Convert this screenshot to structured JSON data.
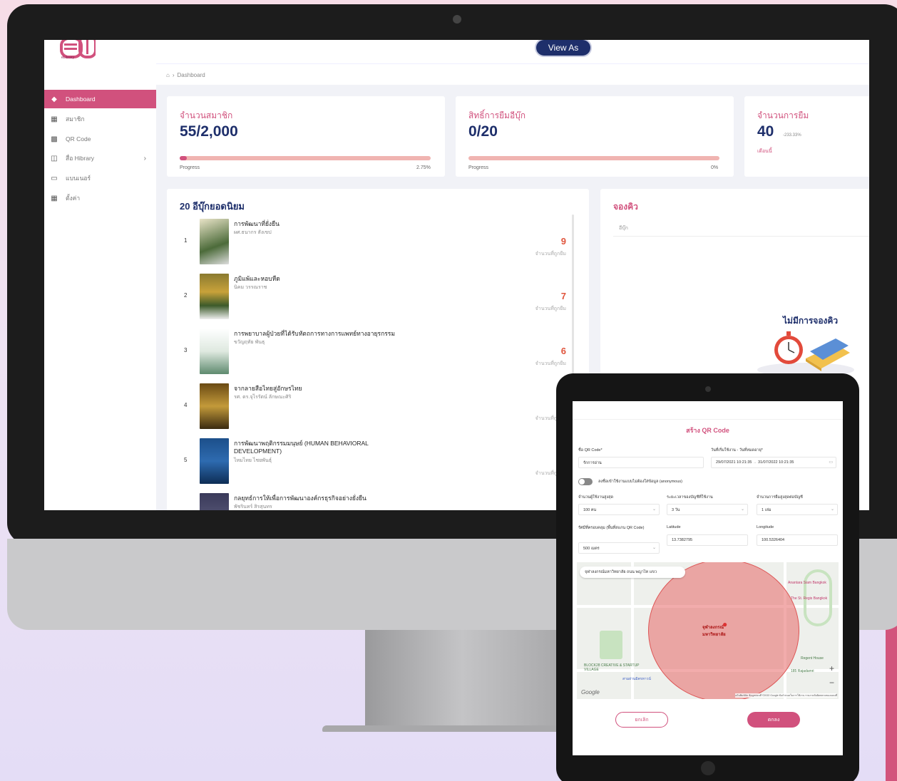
{
  "topbar": {
    "logo_text": "eLibrary",
    "view_as_label": "View As"
  },
  "breadcrumb": {
    "current": "Dashboard"
  },
  "sidebar": {
    "items": [
      {
        "label": "Dashboard",
        "icon": "home-icon"
      },
      {
        "label": "สมาชิก",
        "icon": "members-icon"
      },
      {
        "label": "QR Code",
        "icon": "qr-code-icon"
      },
      {
        "label": "สื่อ Hibrary",
        "icon": "book-icon"
      },
      {
        "label": "แบนเนอร์",
        "icon": "banner-icon"
      },
      {
        "label": "ตั้งค่า",
        "icon": "settings-icon"
      }
    ]
  },
  "stats": {
    "members": {
      "title": "จำนวนสมาชิก",
      "value": "55/2,000",
      "progress_label": "Progress",
      "progress_value": "2.75%",
      "progress": 0.0275
    },
    "rights": {
      "title": "สิทธิ์การยืมอีบุ๊ก",
      "value": "0/20",
      "progress_label": "Progress",
      "progress_value": "0%",
      "progress": 0
    },
    "borrows": {
      "title": "จำนวนการยืม",
      "value": "40",
      "change": "-233.33%",
      "period": "เดือนนี้"
    }
  },
  "popular": {
    "title": "20 อีบุ๊กยอดนิยม",
    "count_label": "จำนวนที่ถูกยืม",
    "books": [
      {
        "rank": "1",
        "title": "การพัฒนาที่ยั่งยืน",
        "author": "ผศ.ธนากร สังเขป",
        "count": "9",
        "cover": "#4c6b3a"
      },
      {
        "rank": "2",
        "title": "ภูมิแพ้และหอบหืด",
        "author": "นิคม วรรณราช",
        "count": "7",
        "cover": "#8a7a30"
      },
      {
        "rank": "3",
        "title": "การพยาบาลผู้ป่วยที่ได้รับหัตถการทางการแพทย์ทางอายุรกรรม",
        "author": "ขวัญฤทัย พันธุ",
        "count": "6",
        "cover": "#5e8a6e"
      },
      {
        "rank": "4",
        "title": "จากลายสือไทยสู่อักษรไทย",
        "author": "รศ. ดร.จุไรรัตน์ ลักษณะศิริ",
        "count": "",
        "cover": "#7a5a1e"
      },
      {
        "rank": "5",
        "title": "การพัฒนาพฤติกรรมมนุษย์ (HUMAN BEHAVIORAL DEVELOPMENT)",
        "author": "ไหมไทย ไชยพันธุ์",
        "count": "",
        "cover": "#1c4f8a"
      },
      {
        "rank": "",
        "title": "กลยุทธ์การให้เพื่อการพัฒนาองค์กรธุรกิจอย่างยั่งยืน",
        "author": "พัชรินทร์ สิรสุนทร",
        "count": "",
        "cover": "#3a3a5a"
      }
    ]
  },
  "queue": {
    "title": "จองคิว",
    "column": "อีบุ๊ก",
    "empty_text": "ไม่มีการจองคิว"
  },
  "qr_dialog": {
    "title": "สร้าง QR Code",
    "name_label": "ชื่อ QR Code*",
    "name_value": "รักการอ่าน",
    "date_label": "วันที่เริ่มใช้งาน - วันที่หมดอายุ*",
    "date_start": "29/07/2021 10:21:35",
    "date_end": "31/07/2022 10:21:35",
    "anon_label": "ลงชื่อเข้าใช้งานแบบไม่ต้องใส่ข้อมูล (anonymous)",
    "max_users_label": "จำนวนผู้ใช้งานสูงสุด",
    "max_users_value": "100 คน",
    "period_label": "ระยะเวลาของบัญชีที่ใช้งาน",
    "period_value": "3 วัน",
    "max_borrow_label": "จำนวนการยืมสูงสุดต่อบัญชี",
    "max_borrow_value": "1 เล่ม",
    "radius_label": "รัศมีที่ครอบคลุม (พื้นที่สแกน QR Code)",
    "radius_value": "500 เมตร",
    "lat_label": "Latitude",
    "lat_value": "13.7382795",
    "lng_label": "Longitude",
    "lng_value": "100.5326404",
    "map_search": "จุฬาลงกรณ์มหาวิทยาลัย ถนน พญาไท แขว",
    "map_pois": [
      "Anantara Siam Bangkok",
      "The St. Regis Bangkok",
      "BLOCK28 CREATIVE & STARTUP VILLAGE",
      "Regent House",
      "185 Rajadamri",
      "สามย่านมิตรทาวน์",
      "จุฬาลงกรณ์ มหาวิทยาลัย"
    ],
    "google_label": "Google",
    "map_footer": "แป้นพิมพ์ลัด  ข้อมูลแผนที่ ©2022 Google  ข้อกำหนดในการใช้งาน  รายงานข้อผิดพลาดของแผนที่",
    "cancel_label": "ยกเลิก",
    "ok_label": "ตกลง"
  },
  "colors": {
    "accent": "#d1517d",
    "navy": "#1e2f6b",
    "count": "#e0553d"
  }
}
